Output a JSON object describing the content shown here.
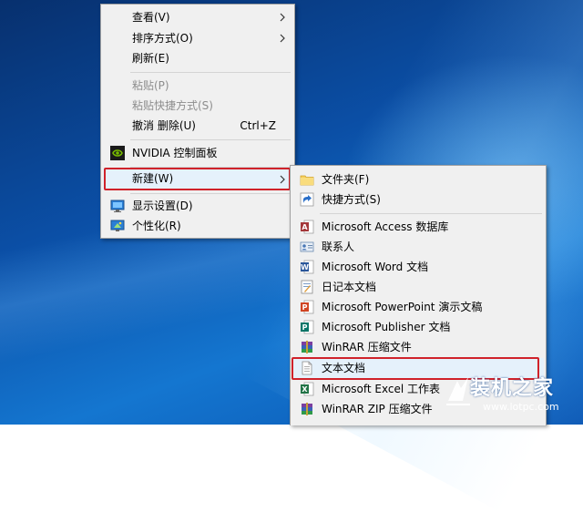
{
  "context_menu": {
    "items": [
      {
        "label": "查看(V)",
        "submenu": true
      },
      {
        "label": "排序方式(O)",
        "submenu": true
      },
      {
        "label": "刷新(E)"
      },
      {
        "label": "粘贴(P)",
        "disabled": true
      },
      {
        "label": "粘贴快捷方式(S)",
        "disabled": true
      },
      {
        "label": "撤消 删除(U)",
        "shortcut": "Ctrl+Z"
      },
      {
        "label": "NVIDIA 控制面板",
        "icon": "nvidia-icon"
      },
      {
        "label": "新建(W)",
        "submenu": true,
        "highlighted": true
      },
      {
        "label": "显示设置(D)",
        "icon": "display-icon"
      },
      {
        "label": "个性化(R)",
        "icon": "personalize-icon"
      }
    ]
  },
  "new_submenu": {
    "items": [
      {
        "label": "文件夹(F)",
        "icon": "folder-icon"
      },
      {
        "label": "快捷方式(S)",
        "icon": "shortcut-icon"
      },
      {
        "label": "Microsoft Access 数据库",
        "icon": "access-icon"
      },
      {
        "label": "联系人",
        "icon": "contact-icon"
      },
      {
        "label": "Microsoft Word 文档",
        "icon": "word-icon"
      },
      {
        "label": "日记本文档",
        "icon": "journal-icon"
      },
      {
        "label": "Microsoft PowerPoint 演示文稿",
        "icon": "powerpoint-icon"
      },
      {
        "label": "Microsoft Publisher 文档",
        "icon": "publisher-icon"
      },
      {
        "label": "WinRAR 压缩文件",
        "icon": "winrar-icon"
      },
      {
        "label": "文本文档",
        "icon": "text-document-icon",
        "highlighted": true
      },
      {
        "label": "Microsoft Excel 工作表",
        "icon": "excel-icon"
      },
      {
        "label": "WinRAR ZIP 压缩文件",
        "icon": "winrar-zip-icon"
      }
    ]
  },
  "colors": {
    "highlight_box": "#d0222a",
    "menu_background": "#f0f0f0",
    "disabled_text": "#8d8d8d"
  },
  "watermark": {
    "text": "装机之家",
    "url": "www.lotpc.com"
  }
}
